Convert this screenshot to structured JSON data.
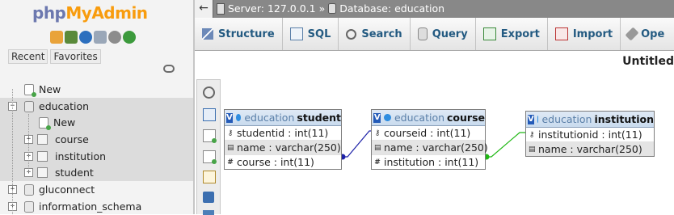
{
  "app": {
    "logo_php": "php",
    "logo_rest": "MyAdmin"
  },
  "nav": {
    "tabs": [
      "Recent",
      "Favorites"
    ],
    "tree": [
      {
        "label": "New",
        "kind": "new",
        "level": 0
      },
      {
        "label": "education",
        "kind": "db",
        "level": 0,
        "expanded": true,
        "highlight": true
      },
      {
        "label": "New",
        "kind": "new",
        "level": 1,
        "highlight": true
      },
      {
        "label": "course",
        "kind": "table",
        "level": 1,
        "highlight": true
      },
      {
        "label": "institution",
        "kind": "table",
        "level": 1,
        "highlight": true
      },
      {
        "label": "student",
        "kind": "table",
        "level": 1,
        "highlight": true
      },
      {
        "label": "gluconnect",
        "kind": "db",
        "level": 0
      },
      {
        "label": "information_schema",
        "kind": "db",
        "level": 0
      }
    ]
  },
  "breadcrumb": {
    "server": "Server: 127.0.0.1",
    "separator": "»",
    "database": "Database: education"
  },
  "toolbar": {
    "structure": "Structure",
    "sql": "SQL",
    "search": "Search",
    "query": "Query",
    "export": "Export",
    "import": "Import",
    "operations": "Ope"
  },
  "designer": {
    "title": "Untitled",
    "tables": [
      {
        "db": "education",
        "name": "student",
        "columns": [
          {
            "text": "studentid : int(11)",
            "icon": "key"
          },
          {
            "text": "name : varchar(250)",
            "icon": "idx"
          },
          {
            "text": "course : int(11)",
            "icon": "fk"
          }
        ]
      },
      {
        "db": "education",
        "name": "course",
        "columns": [
          {
            "text": "courseid : int(11)",
            "icon": "key"
          },
          {
            "text": "name : varchar(250)",
            "icon": "idx"
          },
          {
            "text": "institution : int(11)",
            "icon": "fk"
          }
        ]
      },
      {
        "db": "education",
        "name": "institution",
        "columns": [
          {
            "text": "institutionid : int(11)",
            "icon": "key"
          },
          {
            "text": "name : varchar(250)",
            "icon": "idx"
          }
        ]
      }
    ],
    "relations": [
      {
        "from": "student.course",
        "to": "course.courseid",
        "color": "#1e22a8"
      },
      {
        "from": "course.institution",
        "to": "institution.institutionid",
        "color": "#1fb814"
      }
    ]
  },
  "colors": {
    "topbar": "#888888",
    "toolbar_text": "#235a81",
    "logo_php": "#6c78af",
    "logo_admin": "#f89c0e"
  }
}
